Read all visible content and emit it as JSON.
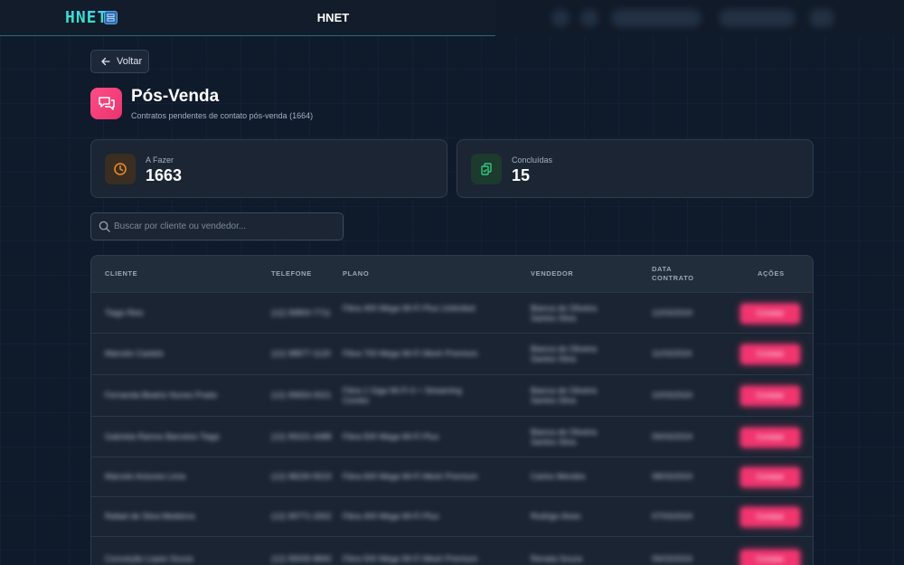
{
  "header": {
    "logo": "HNET",
    "title": "HNET"
  },
  "back_label": "Voltar",
  "page": {
    "title": "Pós-Venda",
    "subtitle": "Contratos pendentes de contato pós-venda (1664)"
  },
  "stats": [
    {
      "label": "A Fazer",
      "value": "1663",
      "icon": "clock-icon",
      "color": "#f08c2a"
    },
    {
      "label": "Concluídas",
      "value": "15",
      "icon": "copy-check-icon",
      "color": "#34c77b"
    }
  ],
  "search": {
    "placeholder": "Buscar por cliente ou vendedor..."
  },
  "table": {
    "columns": [
      "CLIENTE",
      "TELEFONE",
      "PLANO",
      "VENDEDOR",
      "DATA CONTRATO",
      "AÇÕES"
    ],
    "rows": [
      {
        "cliente": "Tiago Reis",
        "telefone": "(12) 99800-7711",
        "plano": "Fibra 400 Mega Wi-Fi Plus Unlimited",
        "vendedor": "Bianca de Oliveira Santos Silva",
        "data": "12/03/2024",
        "acao": "Contatar"
      },
      {
        "cliente": "Marcelo Castelo",
        "telefone": "(12) 98877-1120",
        "plano": "Fibra 700 Mega Wi-Fi Mesh Premium",
        "vendedor": "Bianca de Oliveira Santos Silva",
        "data": "11/03/2024",
        "acao": "Contatar"
      },
      {
        "cliente": "Fernanda Beatriz Nunes Prado",
        "telefone": "(12) 99654-0021",
        "plano": "Fibra 1 Giga Wi-Fi 6 + Streaming Combo",
        "vendedor": "Bianca de Oliveira Santos Silva",
        "data": "10/03/2024",
        "acao": "Contatar"
      },
      {
        "cliente": "Gabriela Ramos Barcelos Tiago",
        "telefone": "(12) 99101-4488",
        "plano": "Fibra 500 Mega Wi-Fi Plus",
        "vendedor": "Bianca de Oliveira Santos Silva",
        "data": "09/03/2024",
        "acao": "Contatar"
      },
      {
        "cliente": "Marcelo Antunes Lima",
        "telefone": "(12) 98230-5519",
        "plano": "Fibra 600 Mega Wi-Fi Mesh Premium",
        "vendedor": "Carlos Mendes",
        "data": "08/03/2024",
        "acao": "Contatar"
      },
      {
        "cliente": "Rafael de Silva Medeiros",
        "telefone": "(12) 99771-3302",
        "plano": "Fibra 400 Mega Wi-Fi Plus",
        "vendedor": "Rodrigo Alves",
        "data": "07/03/2024",
        "acao": "Contatar"
      },
      {
        "cliente": "Conceição Lopes Souza",
        "telefone": "(12) 99005-8840",
        "plano": "Fibra 500 Mega Wi-Fi Mesh Premium",
        "vendedor": "Renata Souza",
        "data": "06/03/2024",
        "acao": "Contatar"
      }
    ]
  }
}
